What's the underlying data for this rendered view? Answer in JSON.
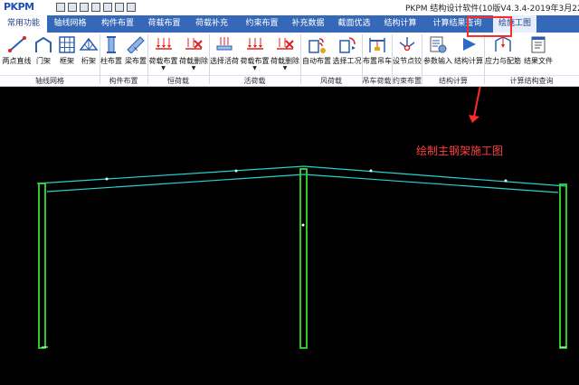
{
  "app": {
    "logo": "PKPM",
    "window_title": "PKPM 结构设计软件(10版V4.3.4-2019年3月22"
  },
  "tabs": [
    {
      "label": "常用功能",
      "state": "active"
    },
    {
      "label": "轴线网格"
    },
    {
      "label": "构件布置"
    },
    {
      "label": "荷载布置"
    },
    {
      "label": "荷载补充"
    },
    {
      "label": "约束布置"
    },
    {
      "label": "补充数据"
    },
    {
      "label": "截面优选"
    },
    {
      "label": "结构计算"
    },
    {
      "label": "计算结果查询"
    },
    {
      "label": "绘施工图",
      "state": "highlighted"
    }
  ],
  "ribbon": {
    "buttons": [
      {
        "label": "两点直线",
        "icon": "two-point-line-icon"
      },
      {
        "label": "门架",
        "icon": "portal-frame-icon"
      },
      {
        "label": "框架",
        "icon": "frame-grid-icon"
      },
      {
        "label": "桁架",
        "icon": "truss-icon"
      },
      {
        "label": "柱布置",
        "icon": "column-place-icon"
      },
      {
        "label": "梁布置",
        "icon": "beam-place-icon"
      },
      {
        "label": "荷载布置",
        "icon": "load-arrows-icon",
        "dropdown": true
      },
      {
        "label": "荷载删除",
        "icon": "load-delete-icon",
        "dropdown": true
      },
      {
        "label": "选择活荷",
        "icon": "live-load-select-icon"
      },
      {
        "label": "荷载布置",
        "icon": "load-arrows-icon",
        "dropdown": true
      },
      {
        "label": "荷载删除",
        "icon": "load-delete-icon",
        "dropdown": true
      },
      {
        "label": "自动布置",
        "icon": "wind-auto-icon"
      },
      {
        "label": "选择工况",
        "icon": "wind-case-icon"
      },
      {
        "label": "布置吊车",
        "icon": "crane-icon"
      },
      {
        "label": "设节点铰",
        "icon": "hinge-icon"
      },
      {
        "label": "参数输入",
        "icon": "parameters-icon"
      },
      {
        "label": "结构计算",
        "icon": "calculate-play-icon"
      },
      {
        "label": "应力与配筋",
        "icon": "stress-icon"
      },
      {
        "label": "结果文件",
        "icon": "result-file-icon"
      }
    ],
    "groups": [
      {
        "label": "轴线网格"
      },
      {
        "label": "构件布置"
      },
      {
        "label": "恒荷载"
      },
      {
        "label": "活荷载"
      },
      {
        "label": "风荷载"
      },
      {
        "label": "吊车荷载"
      },
      {
        "label": "约束布置"
      },
      {
        "label": "结构计算"
      },
      {
        "label": "计算结构查询"
      }
    ]
  },
  "annotation": {
    "label": "绘制主钢架施工图",
    "color": "#ff2a2a"
  },
  "colors": {
    "tab_bar": "#3568b8",
    "column": "#33dd33",
    "rafter": "#29d2d2",
    "background": "#000000"
  }
}
